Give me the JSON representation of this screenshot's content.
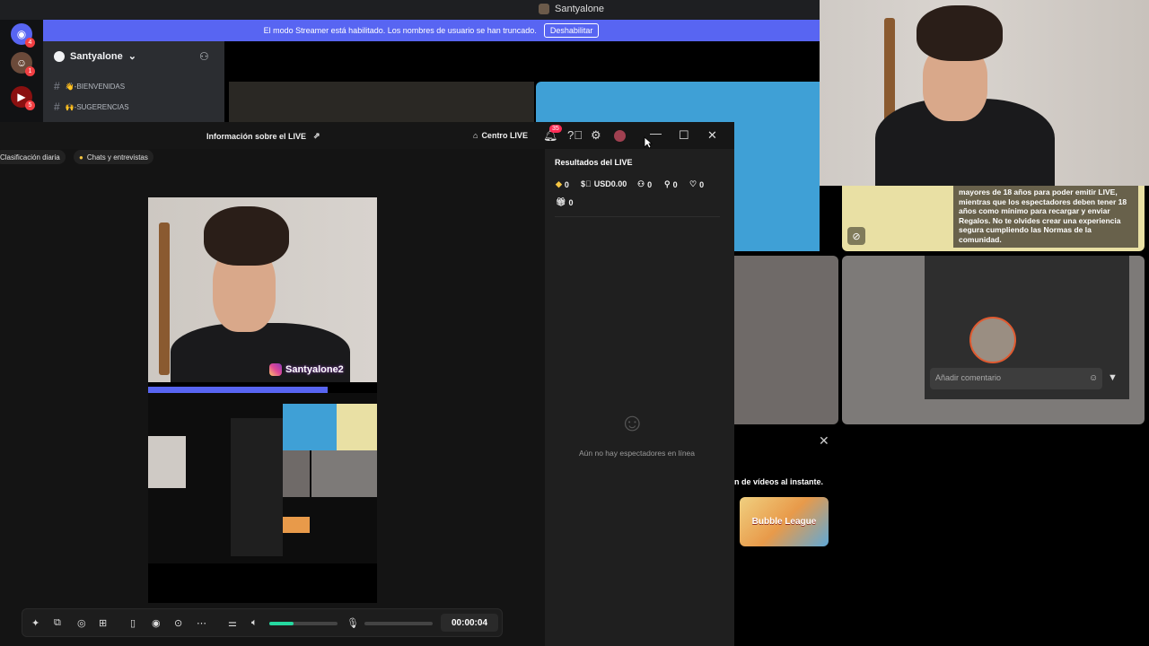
{
  "discord": {
    "window_title": "Santyalone",
    "rail_badges": [
      "4",
      "1",
      "5"
    ],
    "banner_text": "El modo Streamer está habilitado. Los nombres de usuario se han truncado.",
    "banner_button": "Deshabilitar",
    "server_name": "Santyalone",
    "channels": [
      "👋-BIENVENIDAS",
      "🙌-SUGERENCIAS"
    ],
    "yellow_tile_text": "mayores de 18 años para poder emitir LIVE, mientras que los espectadores deben tener 18 años como mínimo para recargar y enviar Regalos. No te olvides crear una experiencia segura cumpliendo las Normas de la comunidad.",
    "comment_placeholder": "Añadir comentario",
    "promo_text": "n de vídeos al instante.",
    "promo_game": "Bubble League"
  },
  "studio": {
    "info_live": "Información sobre el LIVE",
    "centro_live": "Centro LIVE",
    "notification_count": "35",
    "chips": [
      "Clasificación diaria",
      "Chats y entrevistas"
    ],
    "ig_handle": "Santyalone2",
    "timer": "00:00:04",
    "volume_level": 0.35
  },
  "results": {
    "title": "Resultados del LIVE",
    "diamonds": "0",
    "usd": "USD0.00",
    "viewers": "0",
    "shares": "0",
    "likes": "0",
    "gifts": "0",
    "empty_text": "Aún no hay espectadores en línea"
  }
}
